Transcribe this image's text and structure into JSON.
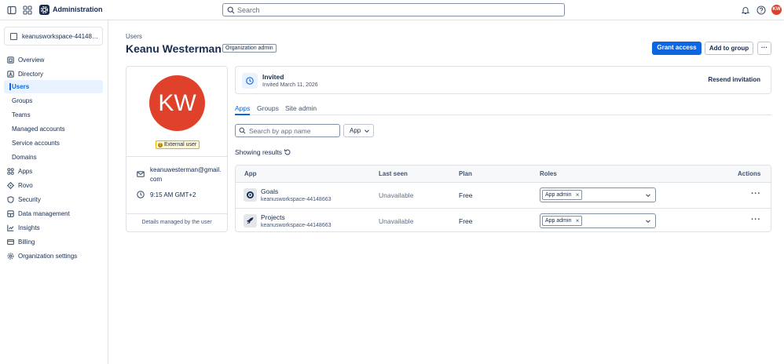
{
  "topbar": {
    "title": "Administration",
    "search_placeholder": "Search",
    "avatar_initials": "KW"
  },
  "sidebar": {
    "workspace": "keanusworkspace-44148663",
    "items": [
      {
        "label": "Overview",
        "icon": "home-icon"
      },
      {
        "label": "Directory",
        "icon": "directory-icon"
      },
      {
        "label": "Users",
        "active": true
      },
      {
        "label": "Groups"
      },
      {
        "label": "Teams"
      },
      {
        "label": "Managed accounts"
      },
      {
        "label": "Service accounts"
      },
      {
        "label": "Domains"
      },
      {
        "label": "Apps",
        "icon": "apps-icon"
      },
      {
        "label": "Rovo",
        "icon": "rovo-icon"
      },
      {
        "label": "Security",
        "icon": "shield-icon"
      },
      {
        "label": "Data management",
        "icon": "database-icon"
      },
      {
        "label": "Insights",
        "icon": "chart-icon"
      },
      {
        "label": "Billing",
        "icon": "card-icon"
      },
      {
        "label": "Organization settings",
        "icon": "gear-icon"
      }
    ]
  },
  "header": {
    "breadcrumb": "Users",
    "name": "Keanu Westerman",
    "role_tag": "Organization admin",
    "grant_label": "Grant access",
    "add_group_label": "Add to group",
    "more_label": "···"
  },
  "profile": {
    "initials": "KW",
    "badge": "External user",
    "email": "keanuwesterman@gmail.com",
    "time": "9:15 AM GMT+2",
    "footer": "Details managed by the user"
  },
  "invite": {
    "title": "Invited",
    "subtitle": "Invited March 11, 2026",
    "resend_label": "Resend invitation"
  },
  "tabs": [
    "Apps",
    "Groups",
    "Site admin"
  ],
  "filters": {
    "search_placeholder": "Search by app name",
    "app_filter_label": "App",
    "showing_label": "Showing results"
  },
  "table": {
    "headers": {
      "app": "App",
      "last_seen": "Last seen",
      "plan": "Plan",
      "roles": "Roles",
      "actions": "Actions"
    },
    "rows": [
      {
        "name": "Goals",
        "workspace": "keanusworkspace-44148663",
        "last_seen": "Unavailable",
        "plan": "Free",
        "role": "App admin",
        "icon": "goals-icon"
      },
      {
        "name": "Projects",
        "workspace": "keanusworkspace-44148663",
        "last_seen": "Unavailable",
        "plan": "Free",
        "role": "App admin",
        "icon": "rocket-icon"
      }
    ]
  },
  "colors": {
    "accent": "#0c66e4",
    "avatar": "#e0412a",
    "badge_bg": "#fff7d6"
  }
}
